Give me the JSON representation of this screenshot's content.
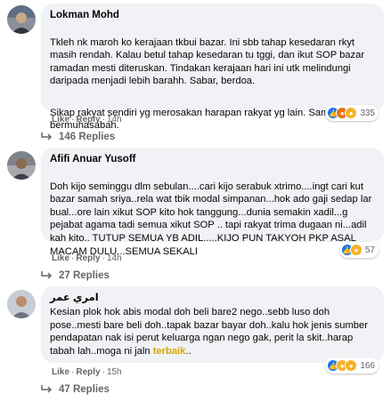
{
  "comments": [
    {
      "author": "Lokman Mohd",
      "paragraphs": [
        "Tkleh nk maroh ko kerajaan tkbui bazar. Ini sbb tahap kesedaran rkyt masih rendah. Kalau betul tahap kesedaran tu tggi, dan ikut SOP bazar ramadan mesti diteruskan. Tindakan kerajaan hari ini utk melindungi daripada menjadi lebih barahh. Sabar, berdoa.",
        "Sikap rakyat sendiri yg merosakan harapan rakyat yg lain. Sama sama bermuhasabah."
      ],
      "like_label": "Like",
      "reply_label": "Reply",
      "time": "14h",
      "reaction_icons": [
        "like-icon",
        "angry-icon",
        "haha-icon"
      ],
      "reaction_count": "335",
      "replies_label": "146 Replies"
    },
    {
      "author": "Afifi Anuar Yusoff",
      "paragraphs": [
        "Doh kijo seminggu dlm sebulan....cari kijo serabuk xtrimo....ingt cari kut bazar samah sriya..rela wat tbik modal simpanan...hok ado gaji sedap lar bual...ore lain xikut SOP kito hok tanggung...dunia semakin xadil...g pejabat agama tadi semua xikut SOP .. tapi rakyat trima dugaan ni...adil kah kito.. TUTUP SEMUA YB ADIL.....KIJO PUN TAKYOH PKP ASAL MACAM DULU...SEMUA SEKALI"
      ],
      "like_label": "Like",
      "reply_label": "Reply",
      "time": "14h",
      "reaction_icons": [
        "like-icon",
        "haha-icon"
      ],
      "reaction_count": "57",
      "replies_label": "27 Replies"
    },
    {
      "author": "امري عمر",
      "text_before": "Kesian plok hok abis modal doh beli bare2 nego..sebb luso doh pose..mesti bare beli doh..tapak bazar bayar doh..kalu hok jenis sumber pendapatan nak isi perut keluarga ngan nego gak, perit la skit..harap tabah lah..moga ni jaln ",
      "text_highlight": "terbaik",
      "text_after": "..",
      "like_label": "Like",
      "reply_label": "Reply",
      "time": "15h",
      "reaction_icons": [
        "like-icon",
        "sad-icon",
        "haha-icon"
      ],
      "reaction_count": "166",
      "replies_label": "47 Replies"
    }
  ]
}
